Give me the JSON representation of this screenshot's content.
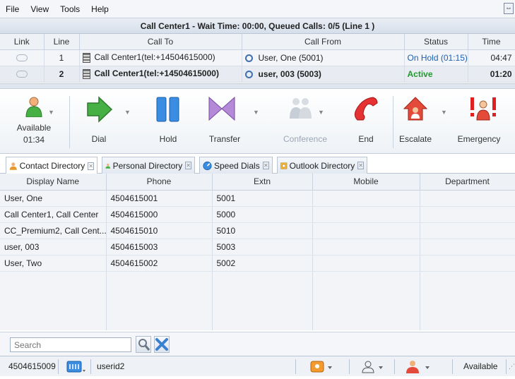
{
  "menu": [
    "File",
    "View",
    "Tools",
    "Help"
  ],
  "calls": {
    "title": "Call Center1 - Wait Time: 00:00, Queued Calls: 0/5 (Line 1 )",
    "columns": [
      "Link",
      "Line",
      "Call To",
      "Call From",
      "Status",
      "Time"
    ],
    "rows": [
      {
        "line": "1",
        "call_to": "Call Center1(tel:+14504615000)",
        "call_from": "User, One (5001)",
        "status": "On Hold (01:15)",
        "time": "04:47"
      },
      {
        "line": "2",
        "call_to": "Call Center1(tel:+14504615000)",
        "call_from": "user, 003 (5003)",
        "status": "Active",
        "time": "01:20"
      }
    ]
  },
  "toolbar": {
    "available": "Available",
    "available_time": "01:34",
    "dial": "Dial",
    "hold": "Hold",
    "transfer": "Transfer",
    "conference": "Conference",
    "end": "End",
    "escalate": "Escalate",
    "emergency": "Emergency"
  },
  "tabs": [
    "Contact Directory",
    "Personal Directory",
    "Speed Dials",
    "Outlook Directory"
  ],
  "directory": {
    "columns": [
      "Display Name",
      "Phone",
      "Extn",
      "Mobile",
      "Department"
    ],
    "rows": [
      {
        "name": "User, One",
        "phone": "4504615001",
        "extn": "5001",
        "mobile": "",
        "dept": ""
      },
      {
        "name": "Call Center1, Call Center",
        "phone": "4504615000",
        "extn": "5000",
        "mobile": "",
        "dept": ""
      },
      {
        "name": "CC_Premium2, Call Cent...",
        "phone": "4504615010",
        "extn": "5010",
        "mobile": "",
        "dept": ""
      },
      {
        "name": "user, 003",
        "phone": "4504615003",
        "extn": "5003",
        "mobile": "",
        "dept": ""
      },
      {
        "name": "User, Two",
        "phone": "4504615002",
        "extn": "5002",
        "mobile": "",
        "dept": ""
      }
    ]
  },
  "search": {
    "placeholder": "Search"
  },
  "statusbar": {
    "number": "4504615009",
    "user": "userid2",
    "state": "Available"
  },
  "colors": {
    "active": "#1f9a2a",
    "hold": "#1d5fb5",
    "end_red": "#e02020",
    "dial_green": "#3fae2a",
    "hold_blue": "#2f7fd6",
    "transfer_purple": "#8b54b8"
  }
}
